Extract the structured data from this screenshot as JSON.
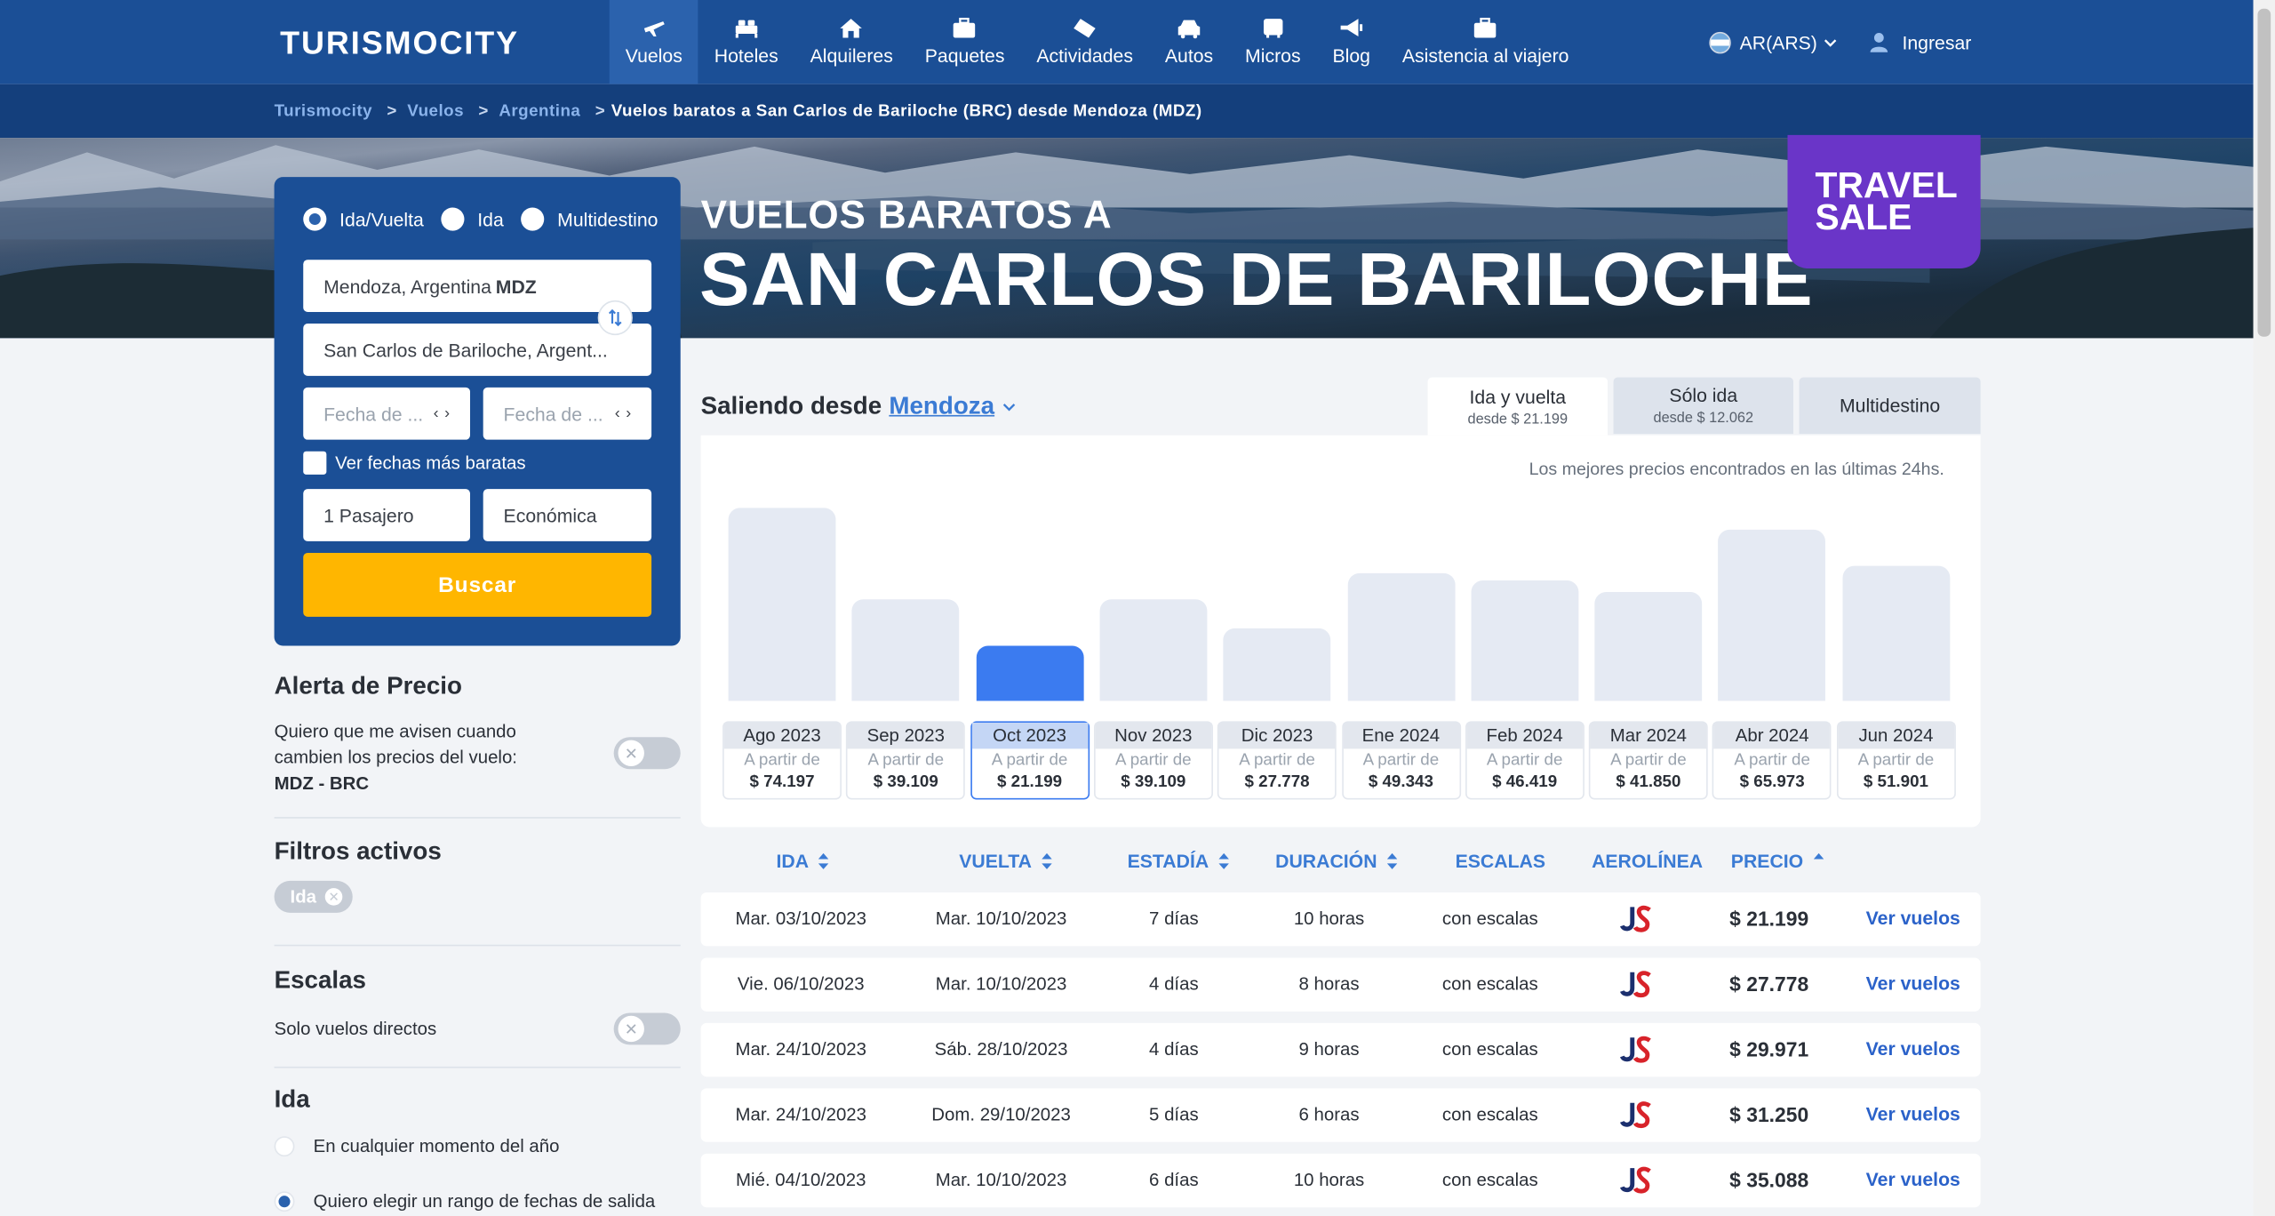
{
  "nav": {
    "logo": "TURISMOCITY",
    "items": [
      {
        "label": "Vuelos",
        "icon": "plane-icon",
        "active": true
      },
      {
        "label": "Hoteles",
        "icon": "bed-icon"
      },
      {
        "label": "Alquileres",
        "icon": "house-icon"
      },
      {
        "label": "Paquetes",
        "icon": "suitcase-icon"
      },
      {
        "label": "Actividades",
        "icon": "ticket-icon"
      },
      {
        "label": "Autos",
        "icon": "car-icon"
      },
      {
        "label": "Micros",
        "icon": "bus-icon"
      },
      {
        "label": "Blog",
        "icon": "megaphone-icon"
      },
      {
        "label": "Asistencia al viajero",
        "icon": "medkit-icon"
      }
    ],
    "currency": "AR(ARS)",
    "login": "Ingresar"
  },
  "breadcrumb": {
    "items": [
      "Turismocity",
      "Vuelos",
      "Argentina"
    ],
    "current": "Vuelos baratos a San Carlos de Bariloche (BRC) desde Mendoza (MDZ)",
    "separator": ">"
  },
  "hero": {
    "subtitle": "VUELOS BARATOS A",
    "title": "SAN CARLOS DE BARILOCHE",
    "sale_badge": [
      "TRAVEL",
      "SALE"
    ]
  },
  "search": {
    "trip_types": [
      {
        "label": "Ida/Vuelta",
        "selected": true
      },
      {
        "label": "Ida",
        "selected": false
      },
      {
        "label": "Multidestino",
        "selected": false
      }
    ],
    "origin_city": "Mendoza, Argentina ",
    "origin_code": "MDZ",
    "destination": "San Carlos de Bariloche, Argent...",
    "date_from_placeholder": "Fecha de ...",
    "date_to_placeholder": "Fecha de ...",
    "cheapest_dates_label": "Ver fechas más baratas",
    "passengers": "1 Pasajero",
    "cabin": "Económica",
    "button": "Buscar"
  },
  "sidebar": {
    "price_alert": {
      "title": "Alerta de Precio",
      "text": "Quiero que me avisen cuando cambien los precios del vuelo:",
      "route": "MDZ - BRC"
    },
    "active_filters": {
      "title": "Filtros activos",
      "chip": "Ida"
    },
    "stops": {
      "title": "Escalas",
      "label": "Solo vuelos directos"
    },
    "departure": {
      "title": "Ida",
      "options": [
        {
          "label": "En cualquier momento del año",
          "selected": false
        },
        {
          "label": "Quiero elegir un rango de fechas de salida",
          "selected": true
        }
      ]
    }
  },
  "main": {
    "saliendo_label": "Saliendo desde",
    "saliendo_city": "Mendoza",
    "tabs": [
      {
        "label": "Ida y vuelta",
        "sub": "desde $ 21.199",
        "active": true
      },
      {
        "label": "Sólo ida",
        "sub": "desde $ 12.062",
        "active": false
      },
      {
        "label": "Multidestino",
        "sub": "",
        "active": false
      }
    ],
    "chart_note": "Los mejores precios encontrados en las últimas 24hs.",
    "months": [
      {
        "month": "Ago 2023",
        "from": "A partir de",
        "price": "$ 74.197",
        "value": 74197
      },
      {
        "month": "Sep 2023",
        "from": "A partir de",
        "price": "$ 39.109",
        "value": 39109
      },
      {
        "month": "Oct 2023",
        "from": "A partir de",
        "price": "$ 21.199",
        "value": 21199,
        "selected": true
      },
      {
        "month": "Nov 2023",
        "from": "A partir de",
        "price": "$ 39.109",
        "value": 39109
      },
      {
        "month": "Dic 2023",
        "from": "A partir de",
        "price": "$ 27.778",
        "value": 27778
      },
      {
        "month": "Ene 2024",
        "from": "A partir de",
        "price": "$ 49.343",
        "value": 49343
      },
      {
        "month": "Feb 2024",
        "from": "A partir de",
        "price": "$ 46.419",
        "value": 46419
      },
      {
        "month": "Mar 2024",
        "from": "A partir de",
        "price": "$ 41.850",
        "value": 41850
      },
      {
        "month": "Abr 2024",
        "from": "A partir de",
        "price": "$ 65.973",
        "value": 65973
      },
      {
        "month": "Jun 2024",
        "from": "A partir de",
        "price": "$ 51.901",
        "value": 51901
      }
    ],
    "table": {
      "headers": [
        "IDA",
        "VUELTA",
        "ESTADÍA",
        "DURACIÓN",
        "ESCALAS",
        "AEROLÍNEA",
        "PRECIO"
      ],
      "rows": [
        {
          "ida": "Mar. 03/10/2023",
          "vuelta": "Mar. 10/10/2023",
          "estadia": "7 días",
          "duracion": "10 horas",
          "escalas": "con escalas",
          "precio": "$ 21.199",
          "link": "Ver vuelos"
        },
        {
          "ida": "Vie. 06/10/2023",
          "vuelta": "Mar. 10/10/2023",
          "estadia": "4 días",
          "duracion": "8 horas",
          "escalas": "con escalas",
          "precio": "$ 27.778",
          "link": "Ver vuelos"
        },
        {
          "ida": "Mar. 24/10/2023",
          "vuelta": "Sáb. 28/10/2023",
          "estadia": "4 días",
          "duracion": "9 horas",
          "escalas": "con escalas",
          "precio": "$ 29.971",
          "link": "Ver vuelos"
        },
        {
          "ida": "Mar. 24/10/2023",
          "vuelta": "Dom. 29/10/2023",
          "estadia": "5 días",
          "duracion": "6 horas",
          "escalas": "con escalas",
          "precio": "$ 31.250",
          "link": "Ver vuelos"
        },
        {
          "ida": "Mié. 04/10/2023",
          "vuelta": "Mar. 10/10/2023",
          "estadia": "6 días",
          "duracion": "10 horas",
          "escalas": "con escalas",
          "precio": "$ 35.088",
          "link": "Ver vuelos"
        }
      ]
    }
  },
  "colors": {
    "brand": "#1b4f96",
    "accent": "#3b7bf0",
    "cta": "#ffb600",
    "sale": "#6a35c8"
  }
}
